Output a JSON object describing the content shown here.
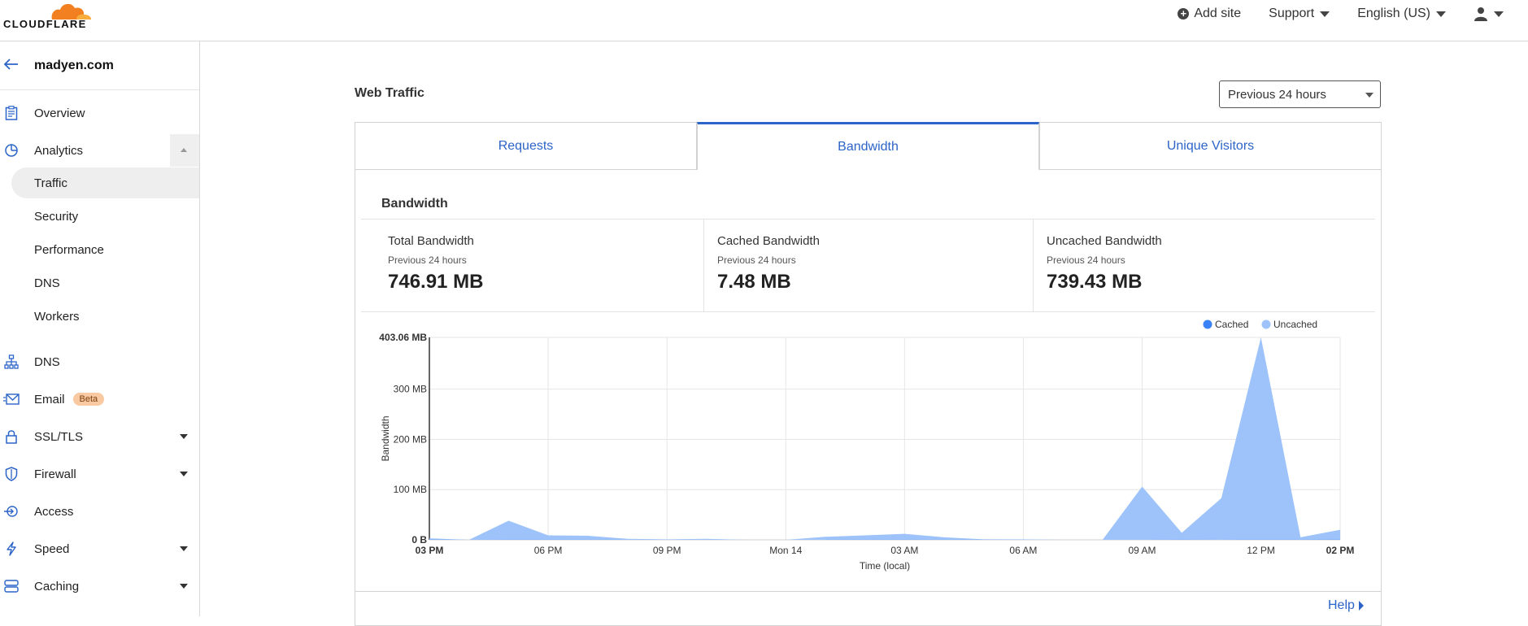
{
  "topbar": {
    "logo_text": "CLOUDFLARE",
    "add_site": "Add site",
    "support": "Support",
    "language": "English (US)"
  },
  "sidebar": {
    "site_name": "madyen.com",
    "items": [
      {
        "label": "Overview",
        "icon": "clipboard-icon"
      },
      {
        "label": "Analytics",
        "icon": "pie-chart-icon"
      },
      {
        "label": "DNS",
        "icon": "network-icon"
      },
      {
        "label": "Email",
        "icon": "email-icon",
        "badge": "Beta"
      },
      {
        "label": "SSL/TLS",
        "icon": "lock-icon"
      },
      {
        "label": "Firewall",
        "icon": "shield-icon"
      },
      {
        "label": "Access",
        "icon": "access-icon"
      },
      {
        "label": "Speed",
        "icon": "lightning-icon"
      },
      {
        "label": "Caching",
        "icon": "server-icon"
      }
    ],
    "analytics_sub": [
      "Traffic",
      "Security",
      "Performance",
      "DNS",
      "Workers"
    ]
  },
  "main": {
    "section_title": "Web Traffic",
    "range_select": "Previous 24 hours",
    "tabs": [
      "Requests",
      "Bandwidth",
      "Unique Visitors"
    ],
    "active_tab": "Bandwidth",
    "card_title": "Bandwidth",
    "stats": [
      {
        "label": "Total Bandwidth",
        "sub": "Previous 24 hours",
        "value": "746.91 MB"
      },
      {
        "label": "Cached Bandwidth",
        "sub": "Previous 24 hours",
        "value": "7.48 MB"
      },
      {
        "label": "Uncached Bandwidth",
        "sub": "Previous 24 hours",
        "value": "739.43 MB"
      }
    ],
    "help": "Help"
  },
  "colors": {
    "accent": "#2c64c8",
    "cached": "#3b82f6",
    "uncached": "#9dc3fa"
  },
  "chart_data": {
    "type": "area",
    "title": "",
    "xlabel": "Time (local)",
    "ylabel": "Bandwidth",
    "x_ticks": [
      "03 PM",
      "06 PM",
      "09 PM",
      "Mon 14",
      "03 AM",
      "06 AM",
      "09 AM",
      "12 PM",
      "02 PM"
    ],
    "y_ticks": [
      "0 B",
      "100 MB",
      "200 MB",
      "300 MB",
      "403.06 MB"
    ],
    "ylim": [
      0,
      403.06
    ],
    "legend": [
      "Cached",
      "Uncached"
    ],
    "legend_position": "top-right",
    "series": [
      {
        "name": "Cached",
        "values": [
          0.5,
          0.1,
          0.2,
          0.3,
          0.2,
          0.1,
          0.1,
          0.1,
          0.1,
          0.1,
          0.1,
          0.2,
          0.2,
          0.2,
          0.2,
          0.1,
          0.1,
          0.1,
          0.1,
          0.2,
          0.1,
          0.2,
          0.3,
          0.5,
          1.0
        ]
      },
      {
        "name": "Uncached",
        "values": [
          3,
          0,
          38,
          9,
          8,
          2,
          1,
          2,
          0,
          0,
          6,
          9,
          12,
          5,
          1,
          1,
          0,
          0,
          106,
          14,
          83,
          403.06,
          5,
          20
        ]
      }
    ],
    "x_hours": [
      0,
      1,
      2,
      3,
      4,
      5,
      6,
      7,
      8,
      9,
      10,
      11,
      12,
      13,
      14,
      15,
      16,
      17,
      18,
      19,
      20,
      21,
      22,
      23
    ]
  }
}
